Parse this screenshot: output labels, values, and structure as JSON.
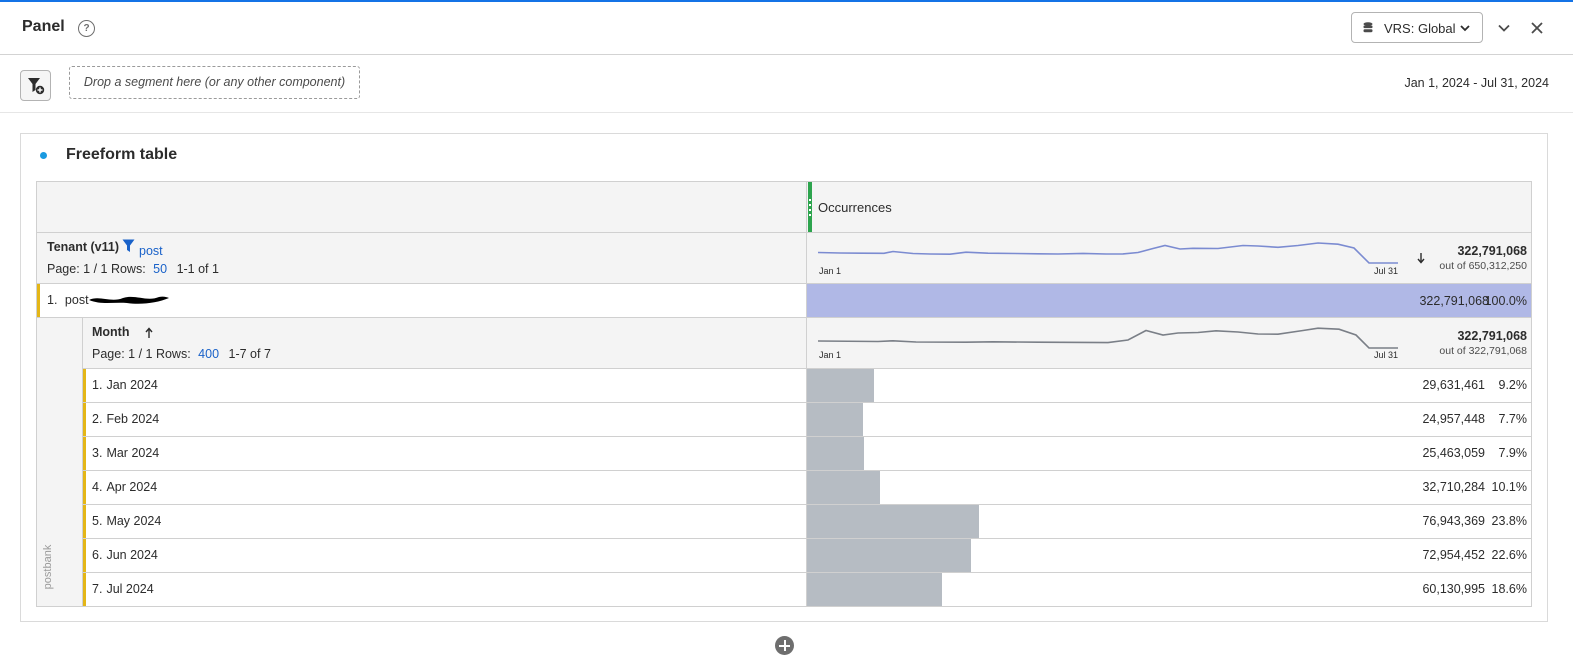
{
  "panel": {
    "title": "Panel",
    "help_symbol": "?",
    "vrs_label": "VRS: Global",
    "vrs_icon": "database-icon",
    "collapse_icon": "chevron-down-icon",
    "close_icon": "close-icon"
  },
  "segment_bar": {
    "filter_icon": "add-filter-icon",
    "drop_placeholder": "Drop a segment here (or any other component)",
    "date_range": "Jan 1, 2024 - Jul 31, 2024"
  },
  "freeform": {
    "title": "Freeform table",
    "metric_header": "Occurrences",
    "dimension": {
      "name": "Tenant (v11)",
      "filter_label": "post",
      "page_label": "Page: 1 / 1",
      "rows_label": "Rows:",
      "rows_value": "50",
      "range": "1-1 of 1",
      "spark_start": "Jan 1",
      "spark_end": "Jul 31",
      "total": "322,791,068",
      "out_of": "out of 650,312,250",
      "sort_icon": "arrow-down-icon"
    },
    "top_row": {
      "index": "1.",
      "label": "post",
      "value": "322,791,068",
      "pct": "100.0%",
      "share": 1.0
    },
    "breakdown": {
      "name": "Month",
      "sort_icon": "arrow-up-icon",
      "page_label": "Page: 1 / 1",
      "rows_label": "Rows:",
      "rows_value": "400",
      "range": "1-7 of 7",
      "spark_start": "Jan 1",
      "spark_end": "Jul 31",
      "total": "322,791,068",
      "out_of": "out of 322,791,068",
      "side_label": "postbank",
      "rows": [
        {
          "index": "1.",
          "label": "Jan 2024",
          "value": "29,631,461",
          "pct": "9.2%",
          "share": 0.092
        },
        {
          "index": "2.",
          "label": "Feb 2024",
          "value": "24,957,448",
          "pct": "7.7%",
          "share": 0.077
        },
        {
          "index": "3.",
          "label": "Mar 2024",
          "value": "25,463,059",
          "pct": "7.9%",
          "share": 0.079
        },
        {
          "index": "4.",
          "label": "Apr 2024",
          "value": "32,710,284",
          "pct": "10.1%",
          "share": 0.101
        },
        {
          "index": "5.",
          "label": "May 2024",
          "value": "76,943,369",
          "pct": "23.8%",
          "share": 0.238
        },
        {
          "index": "6.",
          "label": "Jun 2024",
          "value": "72,954,452",
          "pct": "22.6%",
          "share": 0.226
        },
        {
          "index": "7.",
          "label": "Jul 2024",
          "value": "60,130,995",
          "pct": "18.6%",
          "share": 0.186
        }
      ]
    }
  },
  "add_visualization_icon": "add-circle-icon"
}
